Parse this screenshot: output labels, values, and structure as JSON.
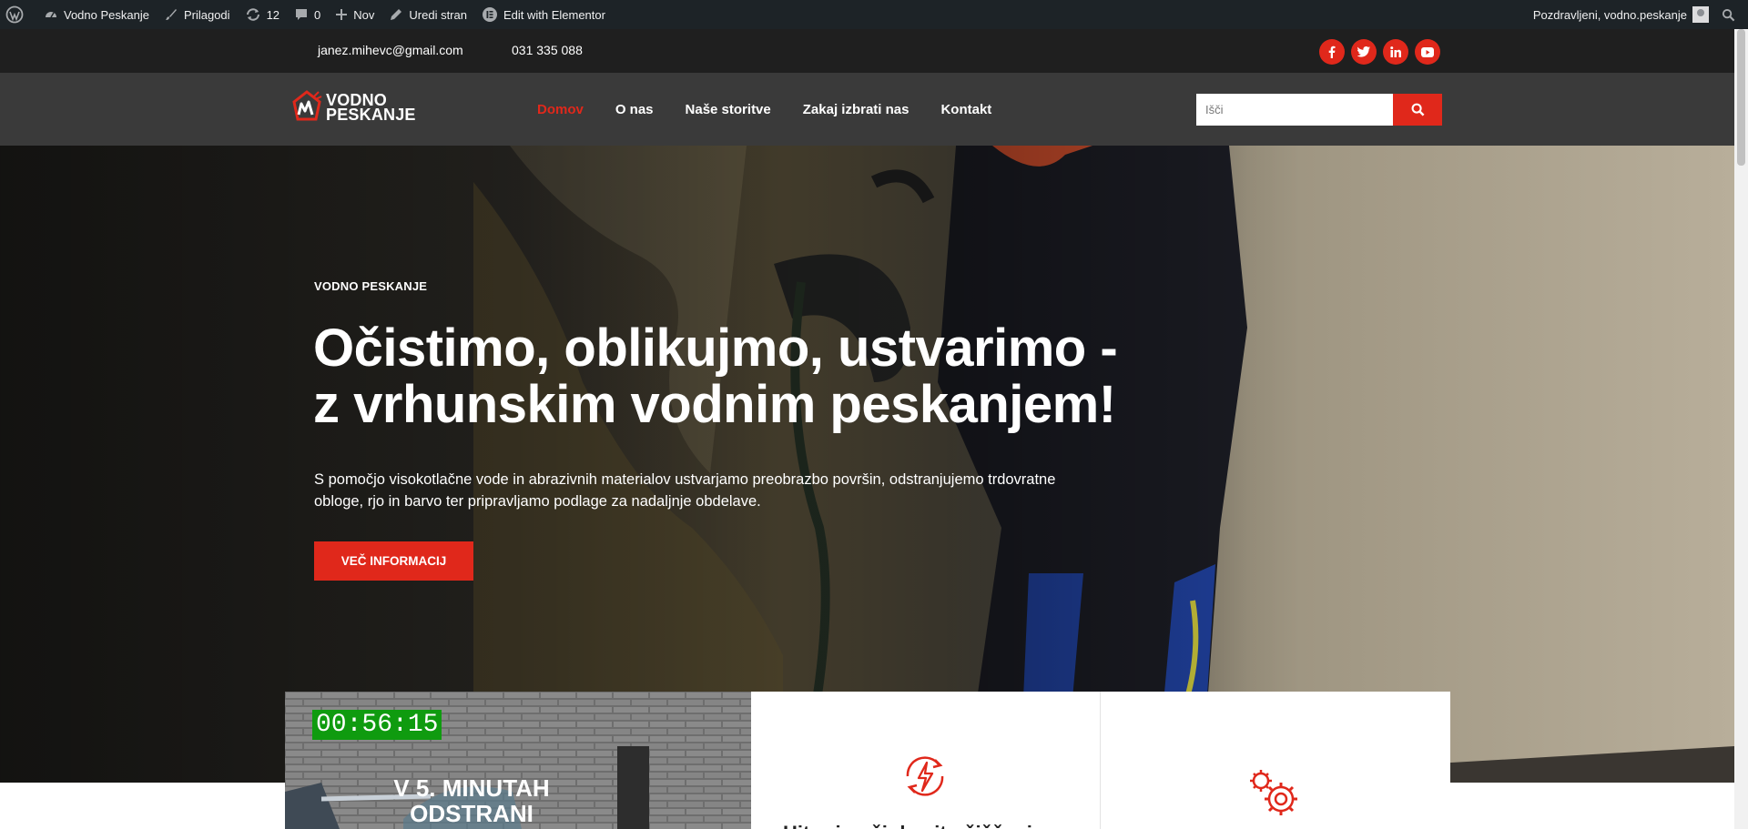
{
  "admin_bar": {
    "items": [
      {
        "label": "Vodno Peskanje",
        "icon": "dashboard-icon"
      },
      {
        "label": "Prilagodi",
        "icon": "brush-icon"
      },
      {
        "label": "12",
        "icon": "updates-icon"
      },
      {
        "label": "0",
        "icon": "comments-icon"
      },
      {
        "label": "Nov",
        "icon": "plus-icon"
      },
      {
        "label": "Uredi stran",
        "icon": "pencil-icon"
      },
      {
        "label": "Edit with Elementor",
        "icon": "elementor-icon"
      }
    ],
    "greeting": "Pozdravljeni, vodno.peskanje"
  },
  "topbar": {
    "email": "janez.mihevc@gmail.com",
    "phone": "031 335 088",
    "socials": [
      "facebook-icon",
      "twitter-icon",
      "linkedin-icon",
      "youtube-icon"
    ]
  },
  "header": {
    "logo_line1": "VODNO",
    "logo_line2": "PESKANJE",
    "nav": [
      {
        "label": "Domov",
        "active": true
      },
      {
        "label": "O nas",
        "active": false
      },
      {
        "label": "Naše storitve",
        "active": false
      },
      {
        "label": "Zakaj izbrati nas",
        "active": false
      },
      {
        "label": "Kontakt",
        "active": false
      }
    ],
    "search_placeholder": "Išči"
  },
  "hero": {
    "kicker": "VODNO PESKANJE",
    "headline_line1": "Očistimo, oblikujmo, ustvarimo -",
    "headline_line2": "z vrhunskim vodnim peskanjem!",
    "lead": "S pomočjo visokotlačne vode in abrazivnih materialov ustvarjamo preobrazbo površin, odstranjujemo trdovratne obloge, rjo in barvo ter pripravljamo podlage za nadaljnje obdelave.",
    "cta": "VEČ INFORMACIJ"
  },
  "cards": {
    "video_timer": "00:56:15",
    "video_text_line1": "V 5. MINUTAH",
    "video_text_line2": "ODSTRANI",
    "feature1_icon": "lightning-cycle-icon",
    "feature1_title": "Hitro in učinkovito čiščenje",
    "feature2_icon": "gears-icon"
  },
  "colors": {
    "accent": "#e0281b",
    "admin_bar": "#1d2327",
    "topbar": "#1f1f1f",
    "header": "#3a3a3a"
  }
}
